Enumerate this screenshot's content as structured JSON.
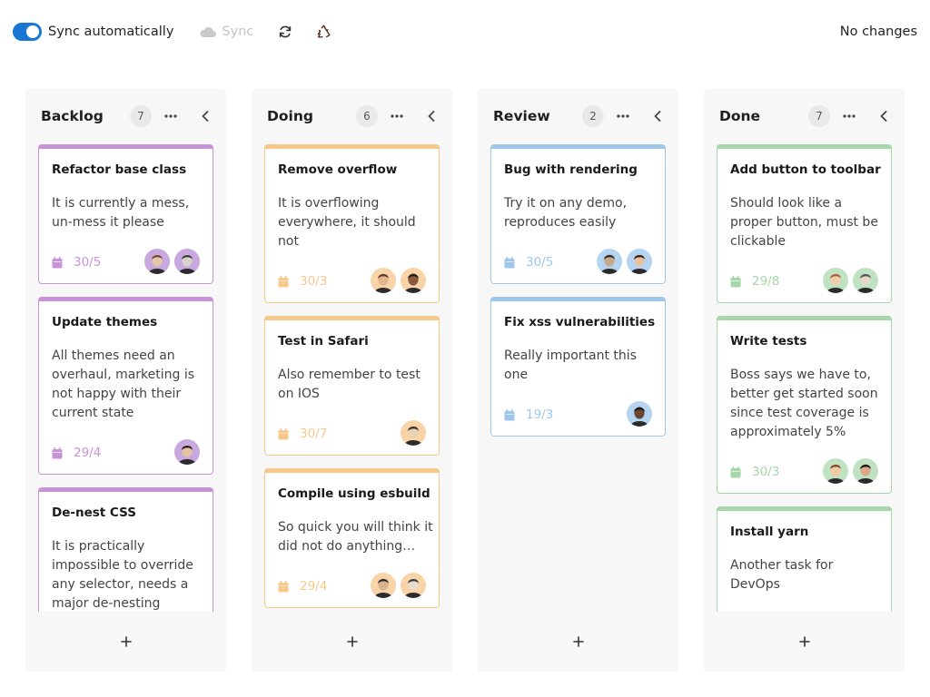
{
  "toolbar": {
    "toggle_label": "Sync automatically",
    "toggle_on": true,
    "sync_label": "Sync",
    "status": "No changes",
    "accent": "#1976d2"
  },
  "columns": [
    {
      "title": "Backlog",
      "count": "7",
      "color": "#c893d9",
      "cards": [
        {
          "title": "Refactor base class",
          "desc": "It is currently a mess, un-mess it please",
          "date": "30/5"
        },
        {
          "title": "Update themes",
          "desc": "All themes need an overhaul, marketing is not happy with their current state",
          "date": "29/4"
        },
        {
          "title": "De-nest CSS",
          "desc": "It is practically impossible to override any selector, needs a major de-nesting",
          "date": ""
        }
      ]
    },
    {
      "title": "Doing",
      "count": "6",
      "color": "#f6c98a",
      "cards": [
        {
          "title": "Remove overflow",
          "desc": "It is overflowing everywhere, it should not",
          "date": "30/3"
        },
        {
          "title": "Test in Safari",
          "desc": "Also remember to test on IOS",
          "date": "30/7"
        },
        {
          "title": "Compile using esbuild",
          "desc": "So quick you will think it did not do anything…",
          "date": "29/4"
        }
      ]
    },
    {
      "title": "Review",
      "count": "2",
      "color": "#9fc7ea",
      "cards": [
        {
          "title": "Bug with rendering",
          "desc": "Try it on any demo, reproduces easily",
          "date": "30/5"
        },
        {
          "title": "Fix xss vulnerabilities",
          "desc": "Really important this one",
          "date": "19/3"
        }
      ]
    },
    {
      "title": "Done",
      "count": "7",
      "color": "#a6d6a9",
      "cards": [
        {
          "title": "Add button to toolbar",
          "desc": "Should look like a proper button, must be clickable",
          "date": "29/8"
        },
        {
          "title": "Write tests",
          "desc": "Boss says we have to, better get started soon since test coverage is approximately 5%",
          "date": "30/3"
        },
        {
          "title": "Install yarn",
          "desc": "Another task for DevOps",
          "date": ""
        }
      ]
    }
  ],
  "icons": {
    "toggle": "toggle-switch-icon",
    "sync": "cloud-icon",
    "refresh": "refresh-icon",
    "recycle": "recycle-icon",
    "menu": "ellipsis-icon",
    "collapse": "chevron-left-icon",
    "date": "calendar-icon",
    "add": "plus-icon"
  }
}
